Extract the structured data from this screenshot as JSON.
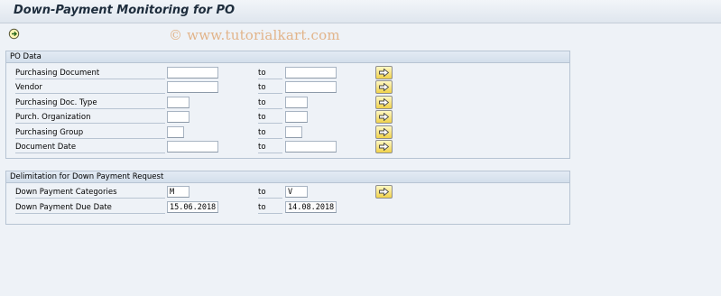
{
  "window": {
    "title": "Down-Payment Monitoring for PO"
  },
  "toolbar": {
    "execute_icon": "execute-icon"
  },
  "watermark": "© www.tutorialkart.com",
  "po_data": {
    "title": "PO Data",
    "rows": [
      {
        "label": "Purchasing Document",
        "from": "",
        "to_label": "to",
        "to": ""
      },
      {
        "label": "Vendor",
        "from": "",
        "to_label": "to",
        "to": ""
      },
      {
        "label": "Purchasing Doc. Type",
        "from": "",
        "to_label": "to",
        "to": ""
      },
      {
        "label": "Purch. Organization",
        "from": "",
        "to_label": "to",
        "to": ""
      },
      {
        "label": "Purchasing Group",
        "from": "",
        "to_label": "to",
        "to": ""
      },
      {
        "label": "Document Date",
        "from": "",
        "to_label": "to",
        "to": ""
      }
    ]
  },
  "delimitation": {
    "title": "Delimitation for Down Payment Request",
    "rows": [
      {
        "label": "Down Payment Categories",
        "from": "M",
        "to_label": "to",
        "to": "V"
      },
      {
        "label": "Down Payment Due Date",
        "from": "15.06.2018",
        "to_label": "to",
        "to": "14.08.2018"
      }
    ]
  },
  "icons": {
    "multiple_selection": "arrow-right-icon",
    "execute": "clock-execute-icon"
  }
}
